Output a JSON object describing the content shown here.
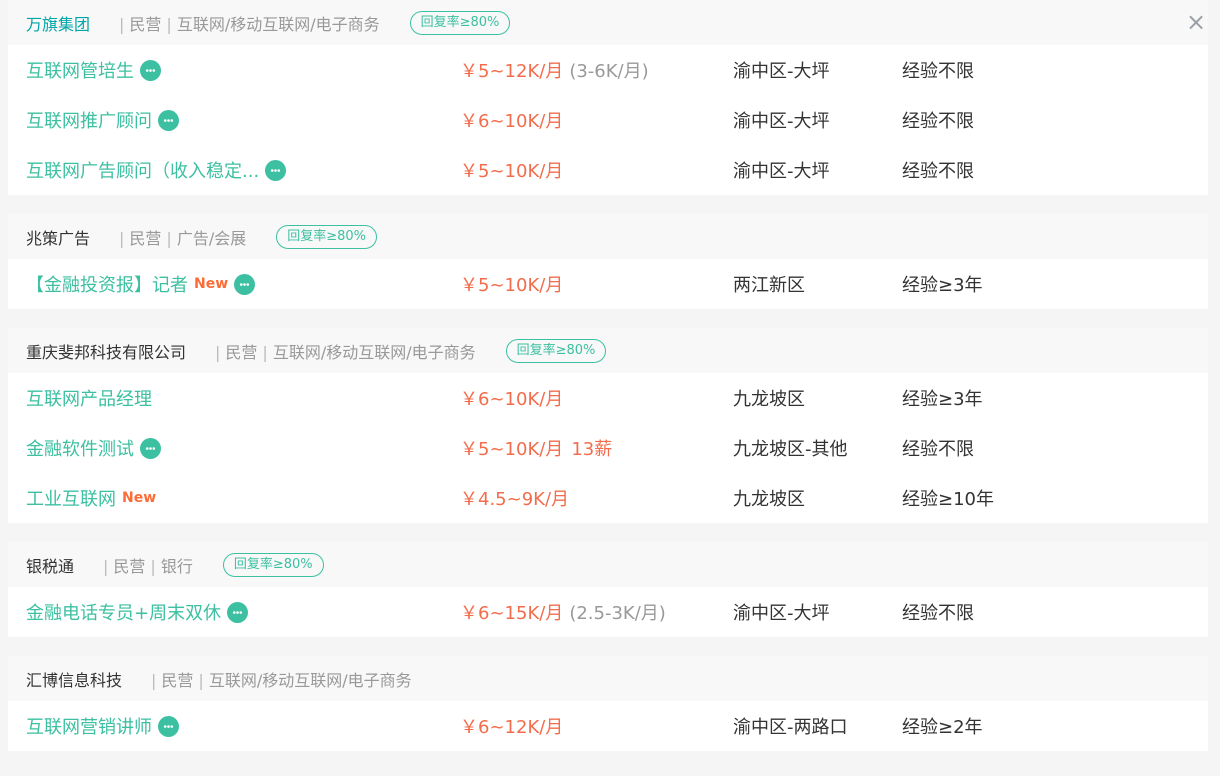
{
  "close_icon": "×",
  "companies": [
    {
      "name": "万旗集团",
      "meta": [
        "民营",
        "互联网/移动互联网/电子商务"
      ],
      "badge": "回复率≥80%",
      "jobs": [
        {
          "title": "互联网管培生",
          "new": "",
          "chat": true,
          "salary": "￥5~12K/月",
          "salary_sub": "(3-6K/月)",
          "bonus": "",
          "location": "渝中区-大坪",
          "experience": "经验不限"
        },
        {
          "title": "互联网推广顾问",
          "new": "",
          "chat": true,
          "salary": "￥6~10K/月",
          "salary_sub": "",
          "bonus": "",
          "location": "渝中区-大坪",
          "experience": "经验不限"
        },
        {
          "title": "互联网广告顾问（收入稳定...",
          "new": "",
          "chat": true,
          "salary": "￥5~10K/月",
          "salary_sub": "",
          "bonus": "",
          "location": "渝中区-大坪",
          "experience": "经验不限"
        }
      ]
    },
    {
      "name": "兆策广告",
      "meta": [
        "民营",
        "广告/会展"
      ],
      "badge": "回复率≥80%",
      "jobs": [
        {
          "title": "【金融投资报】记者",
          "new": "New",
          "chat": true,
          "salary": "￥5~10K/月",
          "salary_sub": "",
          "bonus": "",
          "location": "两江新区",
          "experience": "经验≥3年"
        }
      ]
    },
    {
      "name": "重庆斐邦科技有限公司",
      "meta": [
        "民营",
        "互联网/移动互联网/电子商务"
      ],
      "badge": "回复率≥80%",
      "jobs": [
        {
          "title": "互联网产品经理",
          "new": "",
          "chat": false,
          "salary": "￥6~10K/月",
          "salary_sub": "",
          "bonus": "",
          "location": "九龙坡区",
          "experience": "经验≥3年"
        },
        {
          "title": "金融软件测试",
          "new": "",
          "chat": true,
          "salary": "￥5~10K/月",
          "salary_sub": "",
          "bonus": "13薪",
          "location": "九龙坡区-其他",
          "experience": "经验不限"
        },
        {
          "title": "工业互联网",
          "new": "New",
          "chat": false,
          "salary": "￥4.5~9K/月",
          "salary_sub": "",
          "bonus": "",
          "location": "九龙坡区",
          "experience": "经验≥10年"
        }
      ]
    },
    {
      "name": "银税通",
      "meta": [
        "民营",
        "银行"
      ],
      "badge": "回复率≥80%",
      "jobs": [
        {
          "title": "金融电话专员+周末双休",
          "new": "",
          "chat": true,
          "salary": "￥6~15K/月",
          "salary_sub": "(2.5-3K/月)",
          "bonus": "",
          "location": "渝中区-大坪",
          "experience": "经验不限"
        }
      ]
    },
    {
      "name": "汇博信息科技",
      "meta": [
        "民营",
        "互联网/移动互联网/电子商务"
      ],
      "badge": "",
      "jobs": [
        {
          "title": "互联网营销讲师",
          "new": "",
          "chat": true,
          "salary": "￥6~12K/月",
          "salary_sub": "",
          "bonus": "",
          "location": "渝中区-两路口",
          "experience": "经验≥2年"
        }
      ]
    }
  ]
}
